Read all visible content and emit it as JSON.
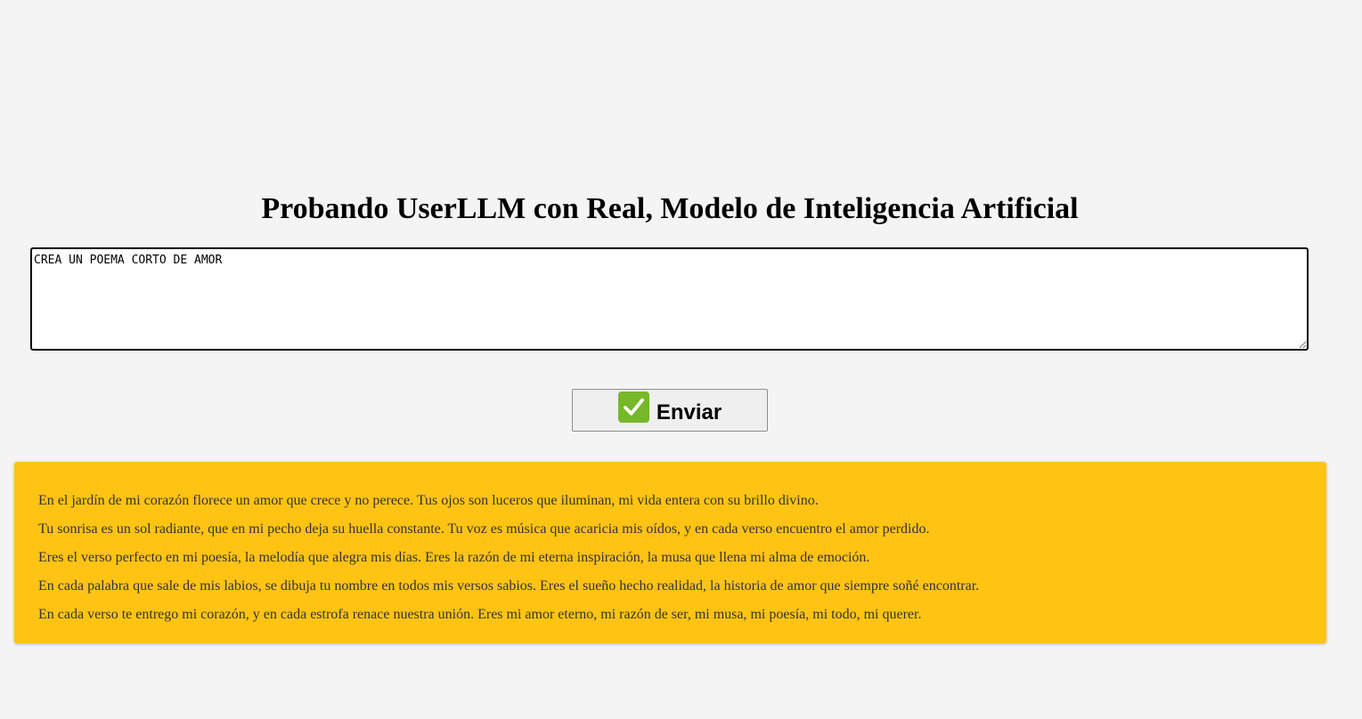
{
  "page": {
    "title": "Probando UserLLM con Real, Modelo de Inteligencia Artificial"
  },
  "prompt": {
    "value": "CREA UN POEMA CORTO DE AMOR"
  },
  "send_button": {
    "label": "Enviar",
    "icon": "check-mark-icon"
  },
  "response": {
    "lines": [
      "En el jardín de mi corazón florece un amor que crece y no perece. Tus ojos son luceros que iluminan, mi vida entera con su brillo divino.",
      "Tu sonrisa es un sol radiante, que en mi pecho deja su huella constante. Tu voz es música que acaricia mis oídos, y en cada verso encuentro el amor perdido.",
      "Eres el verso perfecto en mi poesía, la melodía que alegra mis días. Eres la razón de mi eterna inspiración, la musa que llena mi alma de emoción.",
      "En cada palabra que sale de mis labios, se dibuja tu nombre en todos mis versos sabios. Eres el sueño hecho realidad, la historia de amor que siempre soñé encontrar.",
      "En cada verso te entrego mi corazón, y en cada estrofa renace nuestra unión. Eres mi amor eterno, mi razón de ser, mi musa, mi poesía, mi todo, mi querer."
    ]
  },
  "colors": {
    "background": "#f4f4f4",
    "response_background": "#ffc314",
    "check_icon": "#76b82a"
  }
}
